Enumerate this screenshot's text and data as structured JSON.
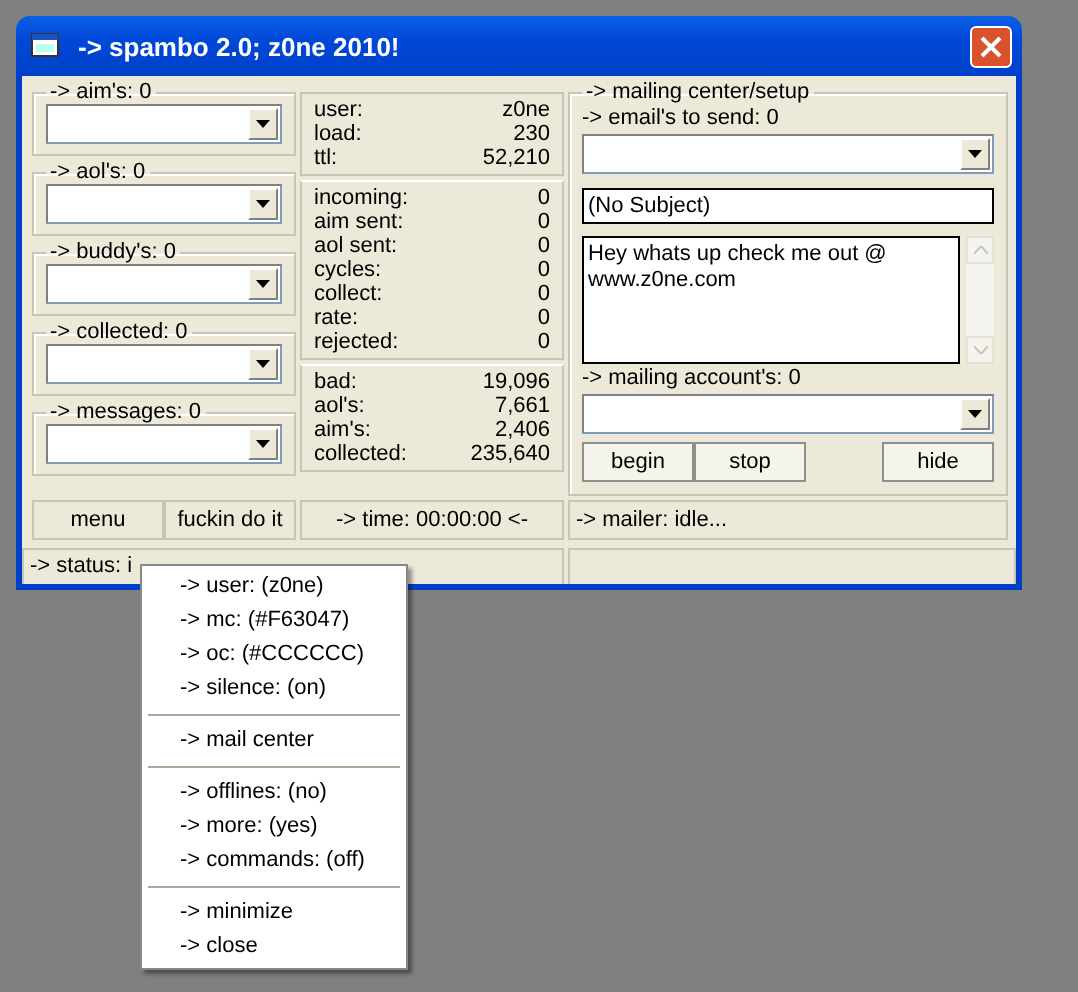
{
  "window": {
    "title": "-> spambo 2.0; z0ne 2010!"
  },
  "lists": [
    {
      "label": "-> aim's: 0"
    },
    {
      "label": "-> aol's: 0"
    },
    {
      "label": "-> buddy's: 0"
    },
    {
      "label": "-> collected: 0"
    },
    {
      "label": "-> messages: 0"
    }
  ],
  "stats": [
    [
      {
        "label": "user:",
        "value": "z0ne"
      },
      {
        "label": "load:",
        "value": "230"
      },
      {
        "label": "ttl:",
        "value": "52,210"
      }
    ],
    [
      {
        "label": "incoming:",
        "value": "0"
      },
      {
        "label": "aim sent:",
        "value": "0"
      },
      {
        "label": "aol sent:",
        "value": "0"
      },
      {
        "label": "cycles:",
        "value": "0"
      },
      {
        "label": "collect:",
        "value": "0"
      },
      {
        "label": "rate:",
        "value": "0"
      },
      {
        "label": "rejected:",
        "value": "0"
      }
    ],
    [
      {
        "label": "bad:",
        "value": "19,096"
      },
      {
        "label": "aol's:",
        "value": "7,661"
      },
      {
        "label": "aim's:",
        "value": "2,406"
      },
      {
        "label": "collected:",
        "value": "235,640"
      }
    ]
  ],
  "buttons": [
    "menu",
    "fuckin do it"
  ],
  "timer": "-> time: 00:00:00 <-",
  "mailing": {
    "title": "-> mailing center/setup",
    "emails_label": "-> email's to send: 0",
    "subject": "(No Subject)",
    "message": "Hey whats up check me out @ www.z0ne.com",
    "accounts_label": "-> mailing account's: 0",
    "buttons": [
      "begin",
      "stop",
      "hide"
    ]
  },
  "mailer_status": "-> mailer: idle...",
  "status_bar": "-> status: i",
  "menu": [
    [
      "-> user: (z0ne)",
      "-> mc: (#F63047)",
      "-> oc: (#CCCCCC)",
      "-> silence: (on)"
    ],
    [
      "-> mail center"
    ],
    [
      "-> offlines: (no)",
      "-> more: (yes)",
      "-> commands: (off)"
    ],
    [
      "-> minimize",
      "-> close"
    ]
  ]
}
